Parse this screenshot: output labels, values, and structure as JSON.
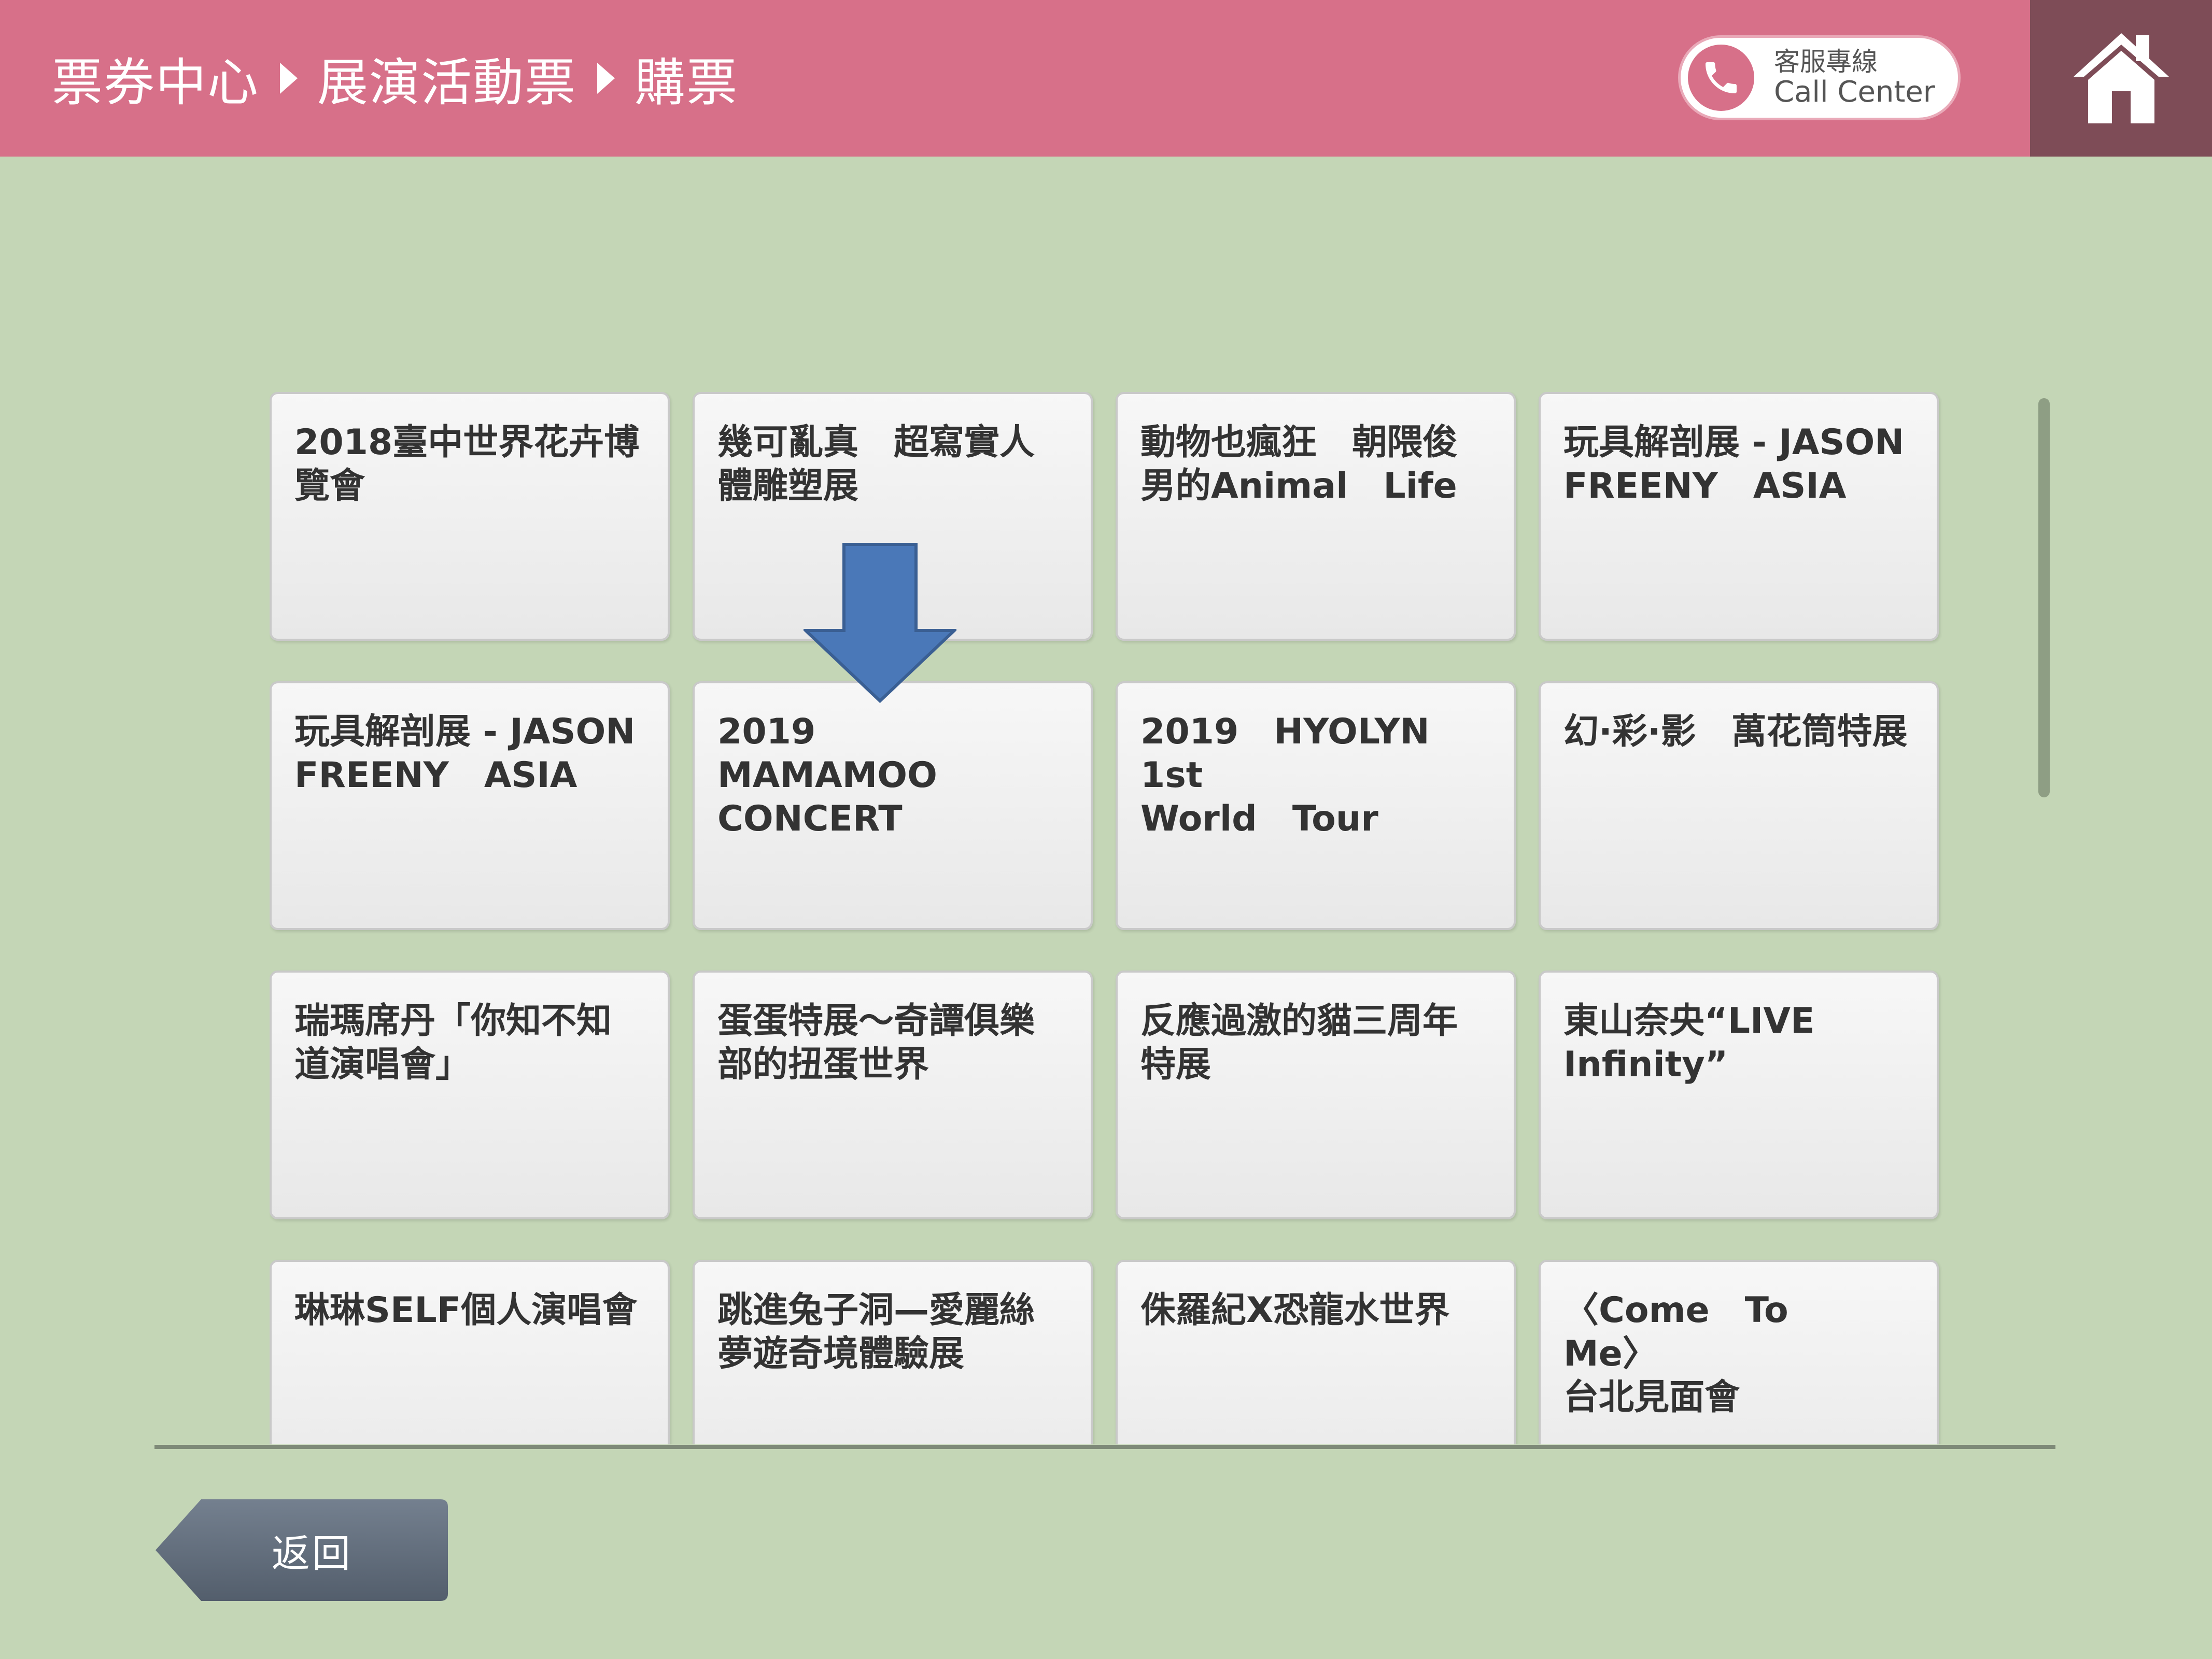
{
  "header": {
    "breadcrumb": [
      "票券中心",
      "展演活動票",
      "購票"
    ],
    "call_center": {
      "label_zh": "客服專線",
      "label_en": "Call Center",
      "icon": "phone-icon"
    },
    "home_icon": "home-icon",
    "background": "#d77089",
    "home_background": "#7e4c57"
  },
  "events": [
    {
      "title": "2018臺中世界花卉博\n覽會"
    },
    {
      "title": "幾可亂真　超寫實人\n體雕塑展"
    },
    {
      "title": "動物也瘋狂　朝隈俊\n男的Animal　Life"
    },
    {
      "title": "玩具解剖展 - JASON\nFREENY　ASIA"
    },
    {
      "title": "玩具解剖展 - JASON\nFREENY　ASIA"
    },
    {
      "title": "2019　MAMAMOO\nCONCERT"
    },
    {
      "title": "2019　HYOLYN　1st\nWorld　Tour"
    },
    {
      "title": "幻·彩·影　萬花筒特展"
    },
    {
      "title": "瑞瑪席丹「你知不知\n道演唱會」"
    },
    {
      "title": "蛋蛋特展～奇譚俱樂\n部的扭蛋世界"
    },
    {
      "title": "反應過激的貓三周年\n特展"
    },
    {
      "title": "東山奈央“LIVE\nInfinity”"
    },
    {
      "title": "琳琳SELF個人演唱會"
    },
    {
      "title": "跳進兔子洞—愛麗絲\n夢遊奇境體驗展"
    },
    {
      "title": "侏羅紀X恐龍水世界"
    },
    {
      "title": "〈Come　To　Me〉\n台北見面會"
    }
  ],
  "annotation": {
    "icon": "down-arrow-icon",
    "color": "#4a78b8"
  },
  "footer": {
    "back_label": "返回",
    "back_color": "#5f6b7c"
  },
  "page_background": "#c4d6b6"
}
